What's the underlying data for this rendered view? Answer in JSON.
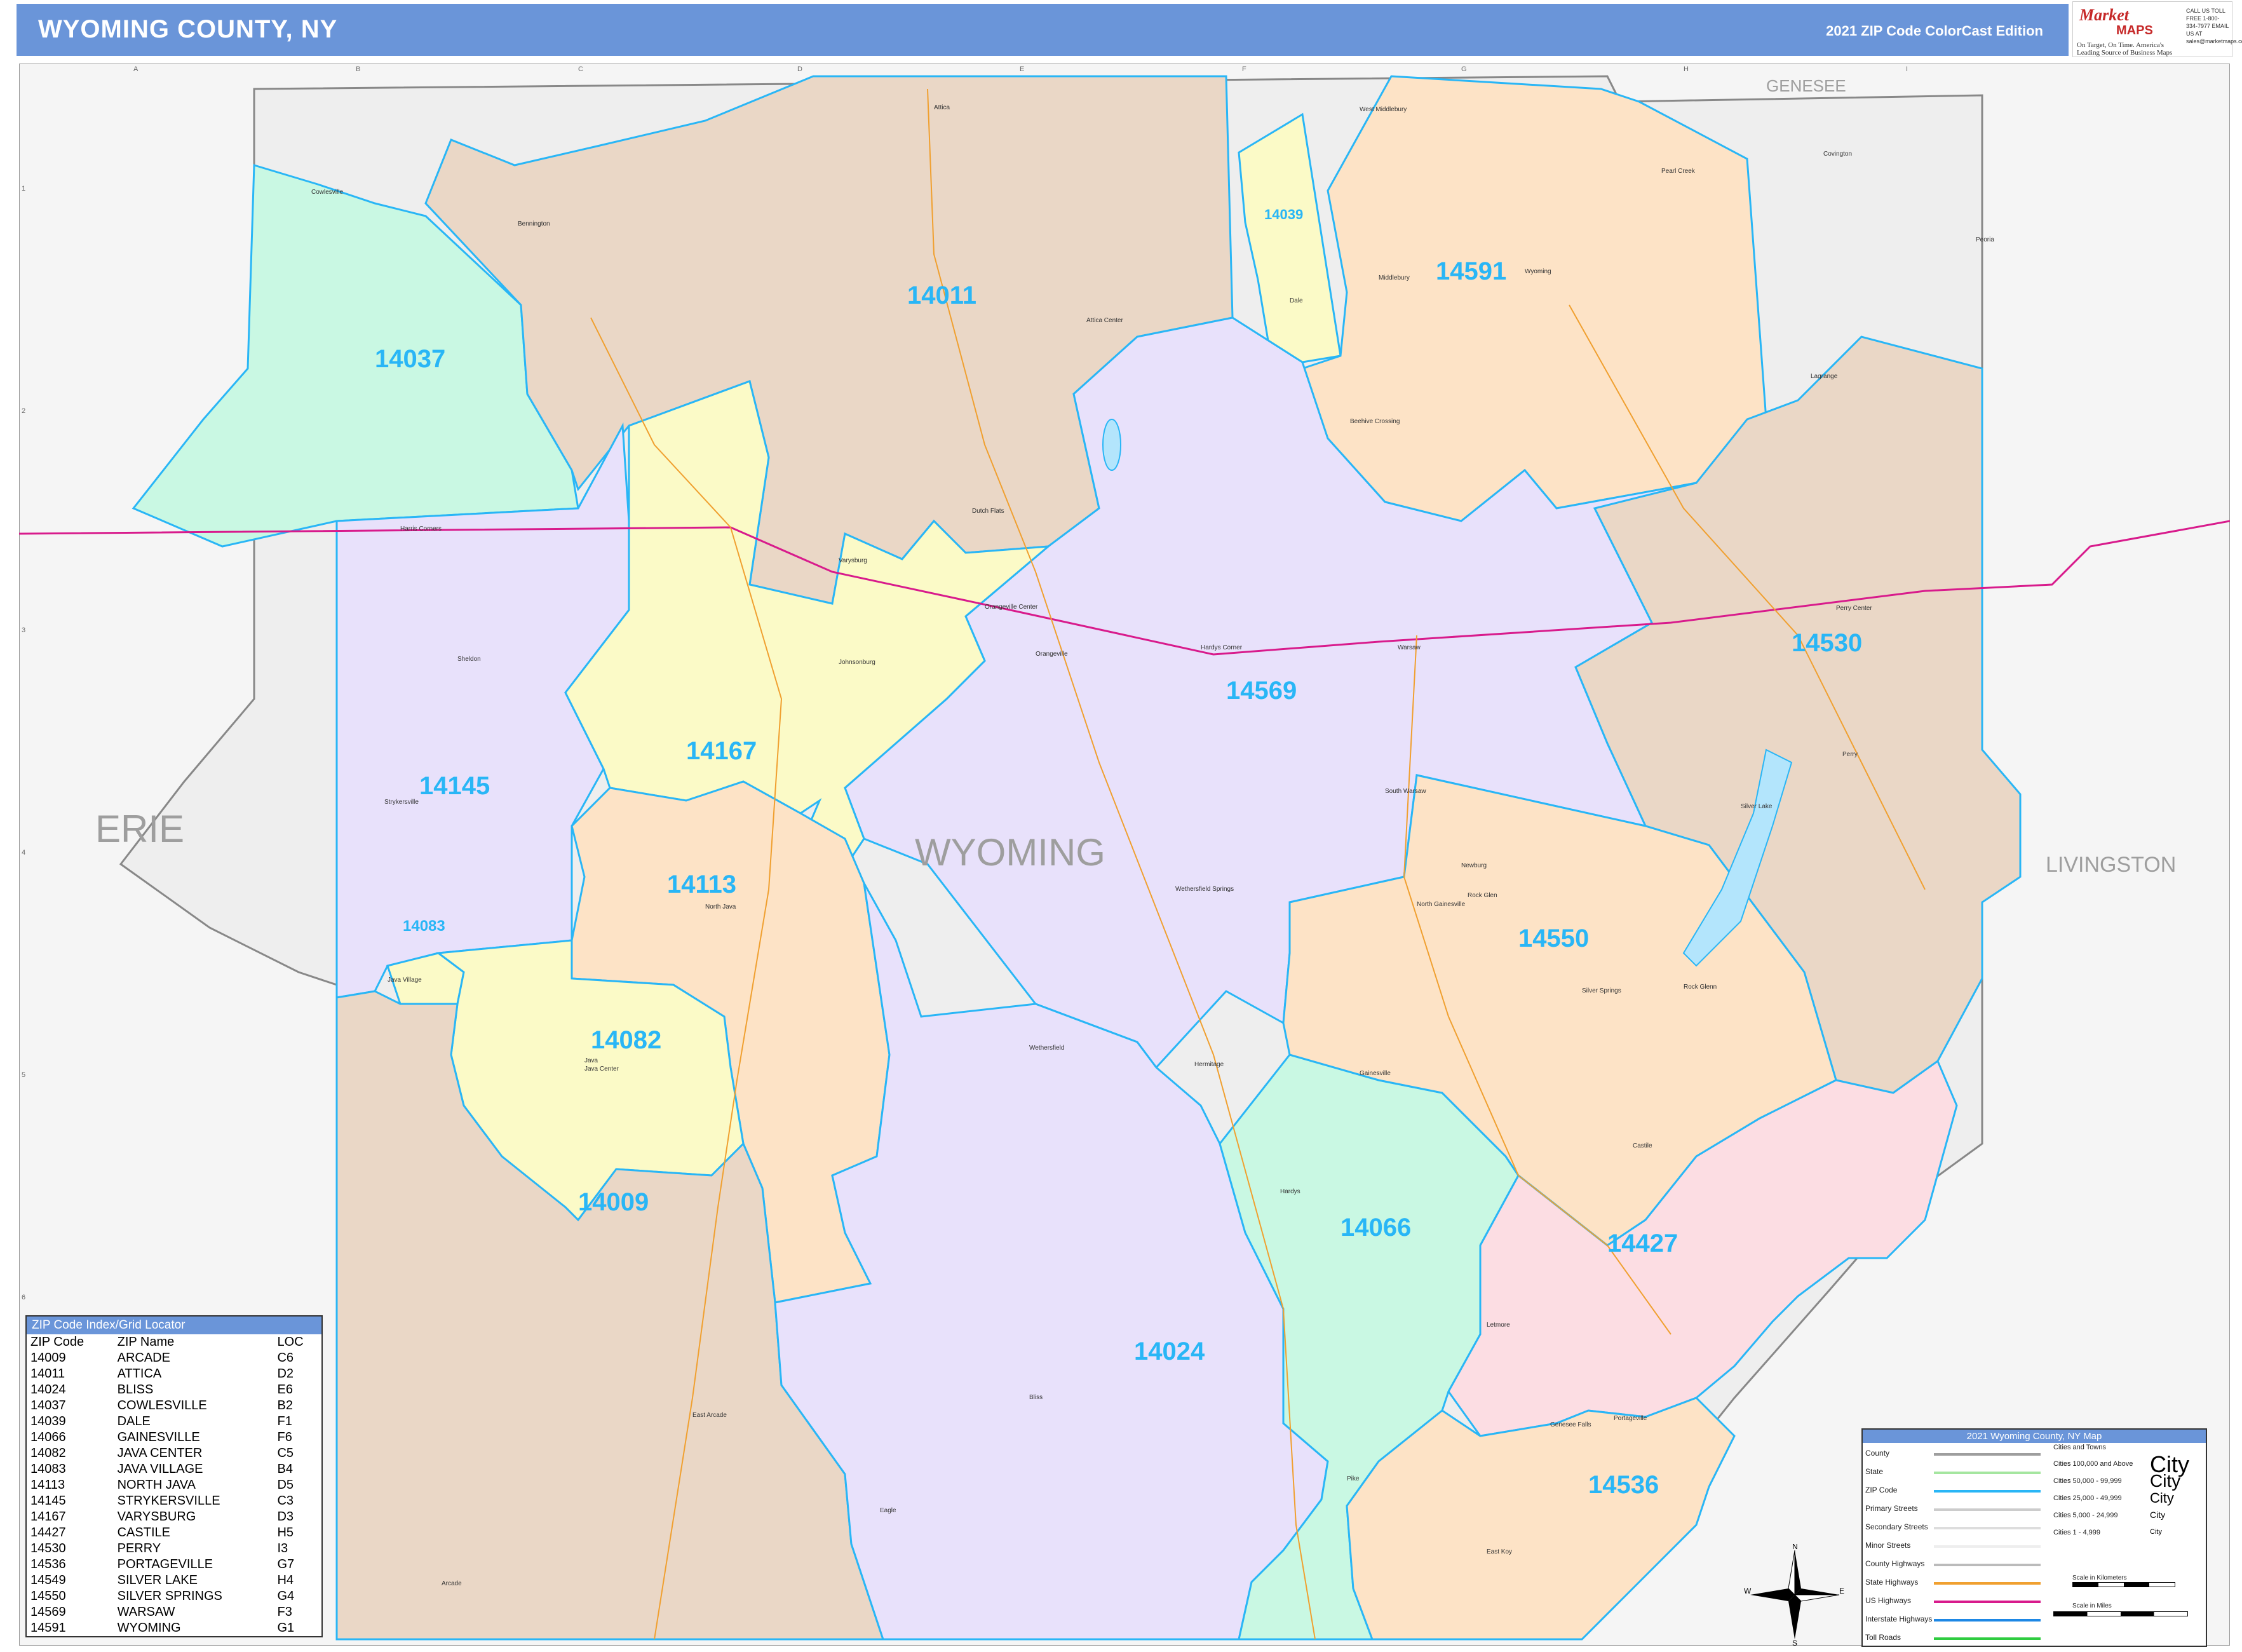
{
  "header": {
    "title": "WYOMING COUNTY, NY",
    "edition": "2021 ZIP Code ColorCast Edition",
    "background_color": "#6a95d9"
  },
  "logo": {
    "brand": "Market",
    "maps": "MAPS",
    "tagline": "On Target, On Time. America's Leading Source of Business Maps",
    "contact": "CALL US TOLL FREE 1-800-334-7977 EMAIL US AT sales@marketmaps.com"
  },
  "map": {
    "county_name": "WYOMING",
    "neighbors": {
      "west": "ERIE",
      "north": "GENESEE",
      "east": "LIVINGSTON"
    },
    "zip_labels": [
      {
        "zip": "14037",
        "color": "#c9f8e3"
      },
      {
        "zip": "14011",
        "color": "#ead7c6"
      },
      {
        "zip": "14039",
        "color": "#fbfac7"
      },
      {
        "zip": "14591",
        "color": "#fde3c6"
      },
      {
        "zip": "14530",
        "color": "#ead7c6"
      },
      {
        "zip": "14569",
        "color": "#e8e1fb"
      },
      {
        "zip": "14145",
        "color": "#e8e1fb"
      },
      {
        "zip": "14167",
        "color": "#fbfac7"
      },
      {
        "zip": "14113",
        "color": "#fde3c6"
      },
      {
        "zip": "14083",
        "color": "#fbfac7"
      },
      {
        "zip": "14082",
        "color": "#fbfac7"
      },
      {
        "zip": "14009",
        "color": "#ead7c6"
      },
      {
        "zip": "14550",
        "color": "#fde3c6"
      },
      {
        "zip": "14066",
        "color": "#c9f8e3"
      },
      {
        "zip": "14427",
        "color": "#fcdde3"
      },
      {
        "zip": "14024",
        "color": "#e8e1fb"
      },
      {
        "zip": "14536",
        "color": "#fde3c6"
      }
    ],
    "towns": [
      "Attica",
      "Cowlesville",
      "Bennington",
      "West Middlebury",
      "Dale",
      "Middlebury",
      "Wyoming",
      "Pearl Creek",
      "Covington",
      "Peoria",
      "Attica Center",
      "Beehive Crossing",
      "Harris Corners",
      "Varysburg",
      "Dutch Flats",
      "Orangeville Center",
      "Orangeville",
      "Johnsonburg",
      "Hardys Corner",
      "Warsaw",
      "Perry Center",
      "Perry",
      "Lagrange",
      "Sheldon",
      "Strykersville",
      "South Warsaw",
      "Silver Lake",
      "Newburg",
      "Rock Glen",
      "North Gainesville",
      "Wethersfield Springs",
      "North Java",
      "Java Village",
      "Java",
      "Java Center",
      "Wethersfield",
      "Hermitage",
      "Gainesville",
      "Silver Springs",
      "Rock Glenn",
      "Castile",
      "Hardys",
      "Letmore",
      "Bliss",
      "East Arcade",
      "Genesee Falls",
      "Portageville",
      "Pike",
      "Eagle",
      "Arcade",
      "East Koy"
    ],
    "grid_cols": [
      "A",
      "B",
      "C",
      "D",
      "E",
      "F",
      "G",
      "H",
      "I"
    ],
    "grid_rows": [
      "1",
      "2",
      "3",
      "4",
      "5",
      "6"
    ]
  },
  "zip_index": {
    "title": "ZIP Code Index/Grid Locator",
    "headers": [
      "ZIP Code",
      "ZIP Name",
      "LOC"
    ],
    "rows": [
      [
        "14009",
        "ARCADE",
        "C6"
      ],
      [
        "14011",
        "ATTICA",
        "D2"
      ],
      [
        "14024",
        "BLISS",
        "E6"
      ],
      [
        "14037",
        "COWLESVILLE",
        "B2"
      ],
      [
        "14039",
        "DALE",
        "F1"
      ],
      [
        "14066",
        "GAINESVILLE",
        "F6"
      ],
      [
        "14082",
        "JAVA CENTER",
        "C5"
      ],
      [
        "14083",
        "JAVA VILLAGE",
        "B4"
      ],
      [
        "14113",
        "NORTH JAVA",
        "D5"
      ],
      [
        "14145",
        "STRYKERSVILLE",
        "C3"
      ],
      [
        "14167",
        "VARYSBURG",
        "D3"
      ],
      [
        "14427",
        "CASTILE",
        "H5"
      ],
      [
        "14530",
        "PERRY",
        "I3"
      ],
      [
        "14536",
        "PORTAGEVILLE",
        "G7"
      ],
      [
        "14549",
        "SILVER LAKE",
        "H4"
      ],
      [
        "14550",
        "SILVER SPRINGS",
        "G4"
      ],
      [
        "14569",
        "WARSAW",
        "F3"
      ],
      [
        "14591",
        "WYOMING",
        "G1"
      ]
    ]
  },
  "legend": {
    "title": "2021 Wyoming County, NY Map",
    "items": [
      {
        "label": "County",
        "color": "#9e9e9e"
      },
      {
        "label": "State",
        "color": "#a5e6a0"
      },
      {
        "label": "ZIP Code",
        "color": "#29b6f6"
      },
      {
        "label": "Primary Streets",
        "color": "#cccccc"
      },
      {
        "label": "Secondary Streets",
        "color": "#dddddd"
      },
      {
        "label": "Minor Streets",
        "color": "#eeeeee"
      },
      {
        "label": "County Highways",
        "color": "#bbbbbb"
      },
      {
        "label": "State Highways",
        "color": "#f0a030"
      },
      {
        "label": "US Highways",
        "color": "#d81b8c"
      },
      {
        "label": "Interstate Highways",
        "color": "#1e88e5"
      },
      {
        "label": "Toll Roads",
        "color": "#2ecc40"
      }
    ],
    "cities_header": "Cities and Towns",
    "cities": [
      {
        "label": "Cities 100,000 and Above",
        "sample": "City"
      },
      {
        "label": "Cities 50,000 - 99,999",
        "sample": "City"
      },
      {
        "label": "Cities 25,000 - 49,999",
        "sample": "City"
      },
      {
        "label": "Cities 5,000 - 24,999",
        "sample": "City"
      },
      {
        "label": "Cities 1 - 4,999",
        "sample": "City"
      }
    ],
    "scale_km": "Scale in Kilometers",
    "scale_mi": "Scale in Miles"
  },
  "compass": {
    "n": "N",
    "s": "S",
    "e": "E",
    "w": "W"
  }
}
